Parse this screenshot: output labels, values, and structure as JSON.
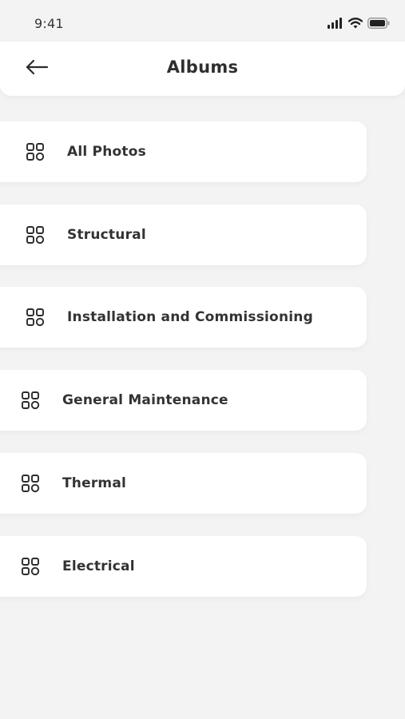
{
  "status_bar": {
    "time": "9:41",
    "signal_icon": "cellular-signal-icon",
    "wifi_icon": "wifi-icon",
    "battery_icon": "battery-icon"
  },
  "header": {
    "title": "Albums",
    "back_icon": "arrow-left-icon"
  },
  "albums": [
    {
      "label": "All Photos",
      "icon": "album-grid-icon"
    },
    {
      "label": "Structural",
      "icon": "album-grid-icon"
    },
    {
      "label": "Installation and Commissioning",
      "icon": "album-grid-icon"
    },
    {
      "label": "General Maintenance",
      "icon": "album-grid-icon"
    },
    {
      "label": "Thermal",
      "icon": "album-grid-icon"
    },
    {
      "label": "Electrical",
      "icon": "album-grid-icon"
    }
  ],
  "colors": {
    "background": "#f3f3f3",
    "card": "#ffffff",
    "text": "#333333"
  }
}
